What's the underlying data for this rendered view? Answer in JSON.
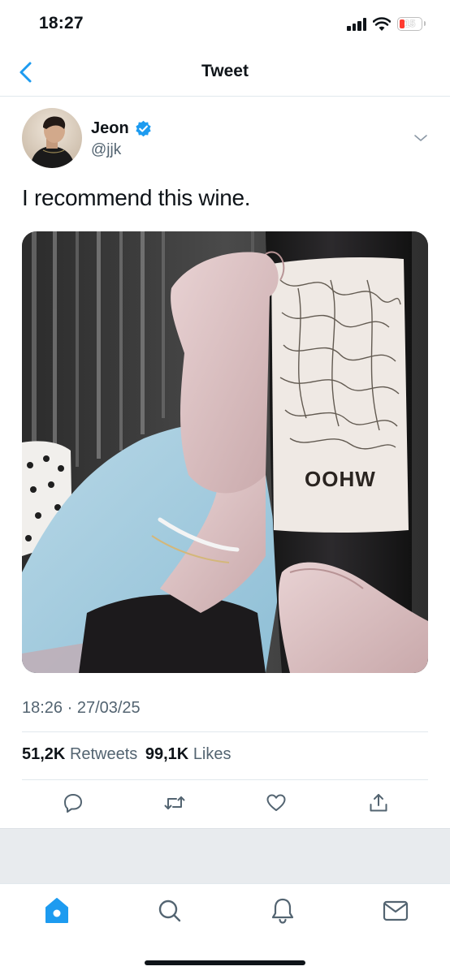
{
  "status_bar": {
    "time": "18:27",
    "battery_level": "15",
    "battery_color": "#ff3b30"
  },
  "nav": {
    "title": "Tweet",
    "back_icon": "chevron-left-icon"
  },
  "tweet": {
    "author_name": "Jeon",
    "handle": "@jjk",
    "verified": true,
    "text": "I recommend this wine.",
    "media": {
      "description_icon": "photo",
      "label_text": "OOHW"
    },
    "timestamp": "18:26 · 27/03/25",
    "retweets_count": "51,2K",
    "retweets_label": "Retweets",
    "likes_count": "99,1K",
    "likes_label": "Likes"
  },
  "actions": [
    {
      "name": "reply",
      "icon": "reply-icon"
    },
    {
      "name": "retweet",
      "icon": "retweet-icon"
    },
    {
      "name": "like",
      "icon": "heart-icon"
    },
    {
      "name": "share",
      "icon": "share-icon"
    }
  ],
  "tabs": [
    {
      "name": "home",
      "icon": "home-icon",
      "active": true
    },
    {
      "name": "search",
      "icon": "search-icon",
      "active": false
    },
    {
      "name": "notifications",
      "icon": "bell-icon",
      "active": false
    },
    {
      "name": "messages",
      "icon": "mail-icon",
      "active": false
    }
  ],
  "colors": {
    "accent": "#1d9bf0",
    "secondary_text": "#536471",
    "divider": "#e1e8ed"
  }
}
